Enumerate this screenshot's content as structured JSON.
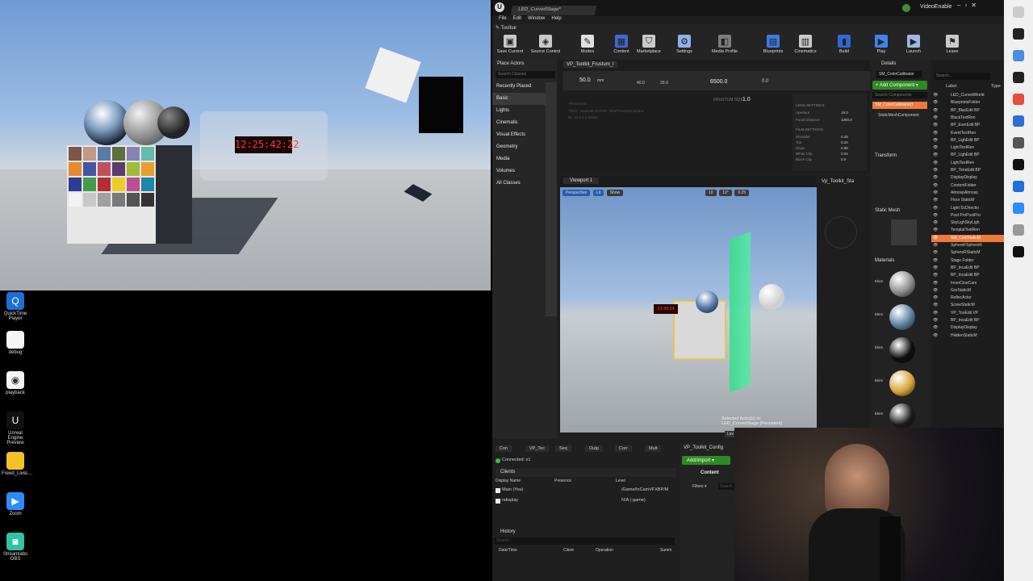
{
  "render": {
    "clock_text": "12:25:42:22",
    "checker_colors": [
      "#7a5646",
      "#c39885",
      "#5c7aa8",
      "#5c6f3d",
      "#8781b5",
      "#63bbb0",
      "#e58a2d",
      "#4655a3",
      "#c0505e",
      "#5c3b6e",
      "#9dbb3c",
      "#e5a02c",
      "#2c3c92",
      "#419d4b",
      "#b62c32",
      "#eccc25",
      "#bb4f94",
      "#1c88a8",
      "#f2f2f2",
      "#c8c8c8",
      "#a0a0a0",
      "#797979",
      "#545454",
      "#333333"
    ]
  },
  "desktop": {
    "icons": [
      {
        "label": "QuickTime Player",
        "color": "#1f6fd6",
        "glyph": "Q"
      },
      {
        "label": "debug",
        "color": "#f5f5f5",
        "glyph": ""
      },
      {
        "label": "playback",
        "color": "#f5f5f5",
        "glyph": "◉"
      },
      {
        "label": "Unreal Engine Preview",
        "color": "#111111",
        "glyph": "U"
      },
      {
        "label": "Freed_LiveL...",
        "color": "#f4c227",
        "glyph": ""
      },
      {
        "label": "Zoom",
        "color": "#2d8cff",
        "glyph": "▶"
      },
      {
        "label": "Streamlabs OBS",
        "color": "#31c3a2",
        "glyph": "◙"
      }
    ]
  },
  "editor": {
    "level_tab": "LED_CurvedStage*",
    "top_right": "VideoEnable",
    "menu": [
      "File",
      "Edit",
      "Window",
      "Help"
    ],
    "toolbar_tab": "Toolbar",
    "toolbar": [
      {
        "label": "Save Current",
        "glyph": "▣",
        "color": "#c9c9c9"
      },
      {
        "label": "Source Control",
        "glyph": "◈",
        "color": "#c9c9c9"
      },
      {
        "label": "Modes",
        "glyph": "✎",
        "color": "#e0e0e0"
      },
      {
        "label": "Content",
        "glyph": "▦",
        "color": "#3f6ad1"
      },
      {
        "label": "Marketplace",
        "glyph": "⛉",
        "color": "#c9c9c9"
      },
      {
        "label": "Settings",
        "glyph": "⚙",
        "color": "#8fb0e8"
      },
      {
        "label": "Media Profile",
        "glyph": "◧",
        "color": "#7d7d7d"
      },
      {
        "label": "Blueprints",
        "glyph": "▤",
        "color": "#3d7be0"
      },
      {
        "label": "Cinematics",
        "glyph": "▥",
        "color": "#c9c9c9"
      },
      {
        "label": "Build",
        "glyph": "▮",
        "color": "#2e66d6"
      },
      {
        "label": "Play",
        "glyph": "▶",
        "color": "#3e82f0"
      },
      {
        "label": "Launch",
        "glyph": "▶",
        "color": "#9fb6e6"
      },
      {
        "label": "Leave",
        "glyph": "⚑",
        "color": "#c9c9c9"
      }
    ],
    "place_actors": {
      "tab": "Place Actors",
      "search_placeholder": "Search Classes",
      "categories": [
        "Recently Placed",
        "Basic",
        "Lights",
        "Cinematic",
        "Visual Effects",
        "Geometry",
        "Media",
        "Volumes",
        "All Classes"
      ]
    },
    "frustum": {
      "tab": "VP_Toolkit_Frustum_I",
      "focal": "50.0",
      "focal_unit": "mm",
      "v1": "40.0",
      "v2": "20.0",
      "kelvin": "6500.0",
      "zero": "0.0",
      "frustum_label": "FRUSTUM SIZE",
      "frustum_val": "1.0",
      "tracking": "TRACKING",
      "track1": "TRCK: LiveLink   ACTOR: InnerFrustumCamera",
      "track2": "ID: 10 9 0.0 50651",
      "lens_settings": "LENS SETTINGS",
      "aperture_label": "Aperture",
      "aperture_val": "18.0",
      "focal_distance_label": "Focal Distance",
      "focal_distance_val": "1000.0",
      "film_settings": "FILM SETTINGS",
      "film": [
        [
          "Shoulder",
          "0.26"
        ],
        [
          "Toe",
          "0.20"
        ],
        [
          "Slope",
          "0.88"
        ],
        [
          "White Clip",
          "0.04"
        ],
        [
          "Black Clip",
          "0.0"
        ]
      ]
    },
    "viewport": {
      "tab": "Viewport 1",
      "side_tab": "Vp_Toolkit_Sta",
      "buttons": [
        "Perspective",
        "Lit",
        "Show"
      ],
      "grid": "10",
      "angle": "10°",
      "scale": "0.25",
      "clock": "22:38:24",
      "selected1": "Selected Actor(s) in:",
      "selected2": "LED_CurvedStage (Persistent)",
      "level_btn": "Lev"
    },
    "details": {
      "tab": "Details",
      "object": "SM_ColorCalibrator",
      "add_component": "+ Add Component ▾",
      "search_components": "Search Components",
      "component_root": "SM_ColorCalibrator(I",
      "component_child": "StaticMeshComponent",
      "transform": "Transform",
      "static_mesh": "Static Mesh",
      "materials": "Materials",
      "element": "Elem"
    },
    "outliner": {
      "search_placeholder": "Search...",
      "col_label": "Label",
      "col_type": "Type",
      "rows": [
        [
          "LED_CurvedWorld",
          ""
        ],
        [
          "BlueprintsFolder",
          ""
        ],
        [
          "BP_BlacEdit BP",
          ""
        ],
        [
          "BlackTextRen",
          ""
        ],
        [
          "BP_EverEdit BP",
          ""
        ],
        [
          "EventTextRen",
          ""
        ],
        [
          "BP_LighEdit BP",
          ""
        ],
        [
          "LightTextRen",
          ""
        ],
        [
          "BP_LighEdit BP",
          ""
        ],
        [
          "LightTextRen",
          ""
        ],
        [
          "BP_TimeEdit BP",
          ""
        ],
        [
          "DisplayDisplay",
          ""
        ],
        [
          "ContentFolder",
          ""
        ],
        [
          "AtmospAtmosp",
          ""
        ],
        [
          "Floor StaticM",
          ""
        ],
        [
          "Light ScDirectio",
          ""
        ],
        [
          "Post ProPostPro",
          ""
        ],
        [
          "SkyLighSkyLigh",
          ""
        ],
        [
          "TemplatTextRen",
          ""
        ],
        [
          "SM_ColcStaticM",
          ""
        ],
        [
          "SphereFSphereR",
          ""
        ],
        [
          "SphereRStaticM",
          ""
        ],
        [
          "Stage Folder",
          ""
        ],
        [
          "BP_IncaEdit BP",
          ""
        ],
        [
          "BP_IncaEdit BP",
          ""
        ],
        [
          "InnerCineCam",
          ""
        ],
        [
          "GreStaticM",
          ""
        ],
        [
          "ReflecActor",
          ""
        ],
        [
          "ScreeStaticM",
          ""
        ],
        [
          "VP_TooEdit VP",
          ""
        ],
        [
          "BP_IncaEdit BP",
          ""
        ],
        [
          "DisplayDisplay",
          ""
        ],
        [
          "HiddenStaticM",
          ""
        ]
      ]
    },
    "bottom": {
      "tabs": [
        "Con",
        "VP_Toc",
        "Seq",
        "Outp",
        "Corr",
        "Mult"
      ],
      "connected": "Connected: s1",
      "clients": "Clients",
      "headers": [
        "Display Name",
        "Presence",
        "Level"
      ],
      "rows": [
        {
          "name": "Main (You)",
          "level": "/Game/InCamVFXBP/M"
        },
        {
          "name": "ndisplay",
          "level": "N/A (-game)"
        }
      ],
      "history": "History",
      "history_search": "Search",
      "history_headers": [
        "Date/Time",
        "Client",
        "Operation",
        "Summ"
      ]
    },
    "content": {
      "tab": "VP_Toolkit_Config",
      "add_import": "Add/Import ▾",
      "label": "Content",
      "filters": "Filters ▾",
      "search": "Search"
    }
  }
}
